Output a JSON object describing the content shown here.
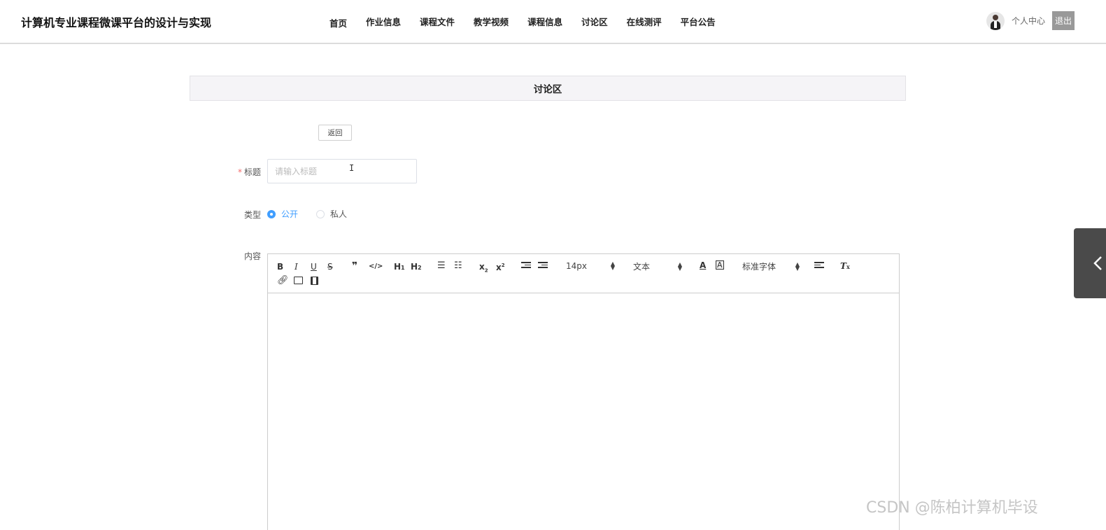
{
  "header": {
    "site_title": "计算机专业课程微课平台的设计与实现",
    "nav": [
      "首页",
      "作业信息",
      "课程文件",
      "教学视频",
      "课程信息",
      "讨论区",
      "在线测评",
      "平台公告"
    ],
    "profile_label": "个人中心",
    "logout_label": "退出"
  },
  "section": {
    "title": "讨论区"
  },
  "back_label": "返回",
  "form": {
    "title_required_mark": "*",
    "title_label": "标题",
    "title_placeholder": "请输入标题",
    "title_value": "",
    "type_label": "类型",
    "type_options": [
      "公开",
      "私人"
    ],
    "type_selected": "公开",
    "content_label": "内容"
  },
  "editor": {
    "font_size": "14px",
    "header_select": "文本",
    "font_family": "标准字体",
    "content": ""
  },
  "watermark": "CSDN @陈柏计算机毕设"
}
